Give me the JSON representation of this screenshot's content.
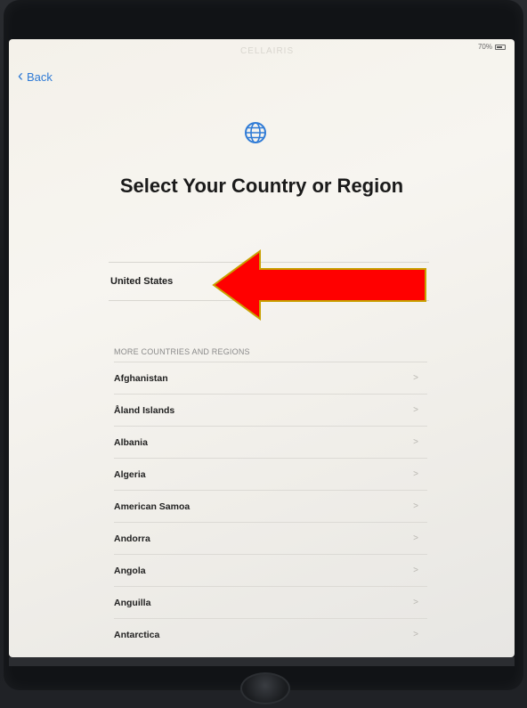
{
  "status": {
    "carrier_text": "CELLAIRIS",
    "battery_text": "70%"
  },
  "nav": {
    "back_label": "Back"
  },
  "header": {
    "title": "Select Your Country or Region"
  },
  "selected": {
    "country": "United States"
  },
  "more": {
    "section_label": "MORE COUNTRIES AND REGIONS",
    "items": [
      {
        "label": "Afghanistan"
      },
      {
        "label": "Åland Islands"
      },
      {
        "label": "Albania"
      },
      {
        "label": "Algeria"
      },
      {
        "label": "American Samoa"
      },
      {
        "label": "Andorra"
      },
      {
        "label": "Angola"
      },
      {
        "label": "Anguilla"
      },
      {
        "label": "Antarctica"
      }
    ],
    "chevron": ">"
  },
  "colors": {
    "accent": "#2f7bd6",
    "arrow_fill": "#ff0000",
    "arrow_stroke": "#c8a000"
  }
}
